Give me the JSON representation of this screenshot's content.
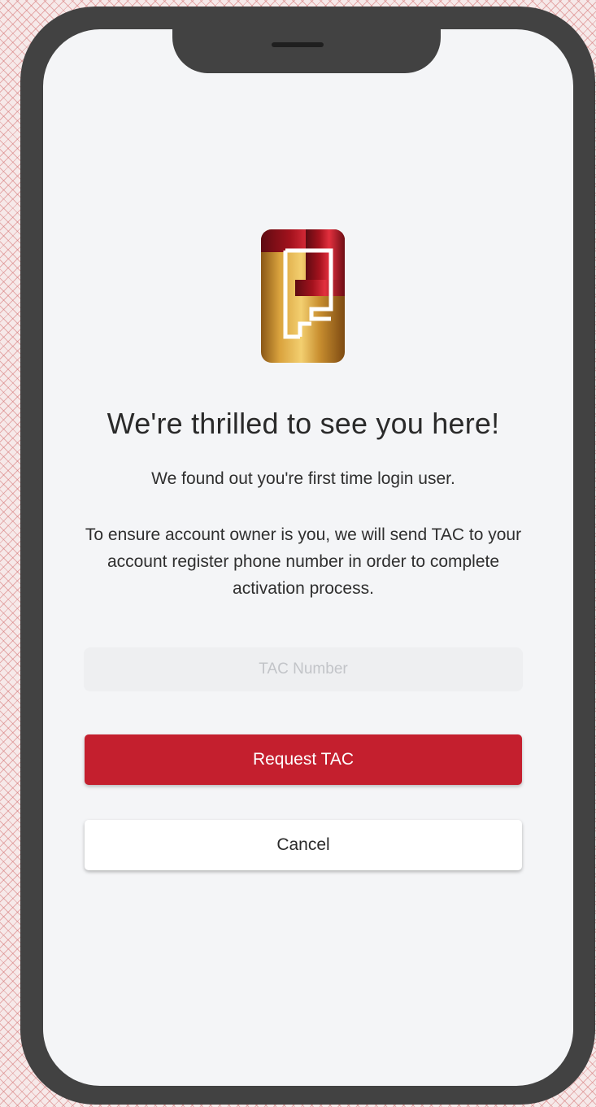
{
  "welcome": {
    "title": "We're thrilled to see you here!",
    "subtitle": "We found out you're first time login user.",
    "description": "To ensure account owner is you, we will send TAC to your account register phone number in order to complete activation process."
  },
  "form": {
    "tac_placeholder": "TAC Number",
    "tac_value": ""
  },
  "actions": {
    "request_label": "Request TAC",
    "cancel_label": "Cancel"
  },
  "colors": {
    "primary": "#c41f2e",
    "frame": "#424242",
    "screen_background": "#f4f5f7"
  },
  "icons": {
    "logo": "brand-logo"
  }
}
